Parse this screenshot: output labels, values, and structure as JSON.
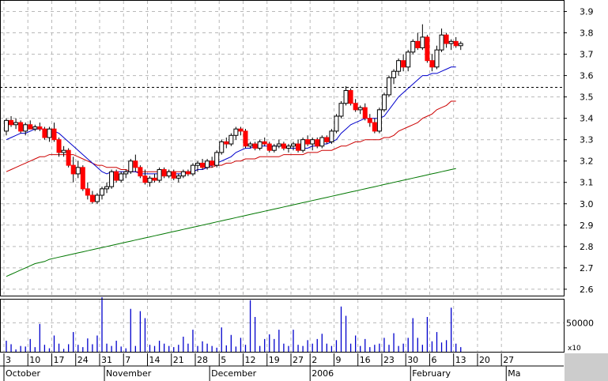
{
  "chart_data": {
    "type": "candlestick",
    "price_axis": {
      "ylim": [
        2.57,
        3.95
      ],
      "ticks": [
        "2.6",
        "2.7",
        "2.8",
        "2.9",
        "3.0",
        "3.1",
        "3.2",
        "3.3",
        "3.4",
        "3.5",
        "3.6",
        "3.7",
        "3.8",
        "3.9"
      ]
    },
    "volume_axis": {
      "ylim": [
        0,
        90000
      ],
      "tick_label": "50000",
      "multiplier_label": "x10"
    },
    "reference_line": 3.545,
    "date_ticks": [
      {
        "i": 0,
        "label": "3"
      },
      {
        "i": 5,
        "label": "10"
      },
      {
        "i": 10,
        "label": "17"
      },
      {
        "i": 15,
        "label": "24"
      },
      {
        "i": 20,
        "label": "31"
      },
      {
        "i": 25,
        "label": "7"
      },
      {
        "i": 30,
        "label": "14"
      },
      {
        "i": 35,
        "label": "21"
      },
      {
        "i": 40,
        "label": "28"
      },
      {
        "i": 45,
        "label": "5"
      },
      {
        "i": 50,
        "label": "12"
      },
      {
        "i": 55,
        "label": "19"
      },
      {
        "i": 60,
        "label": "27"
      },
      {
        "i": 64,
        "label": "2"
      },
      {
        "i": 69,
        "label": "9"
      },
      {
        "i": 74,
        "label": "16"
      },
      {
        "i": 79,
        "label": "23"
      },
      {
        "i": 84,
        "label": "30"
      },
      {
        "i": 89,
        "label": "6"
      },
      {
        "i": 94,
        "label": "13"
      },
      {
        "i": 99,
        "label": "20"
      },
      {
        "i": 104,
        "label": "27"
      }
    ],
    "months": [
      {
        "i": 0,
        "label": "October"
      },
      {
        "i": 21,
        "label": "November"
      },
      {
        "i": 43,
        "label": "December"
      },
      {
        "i": 64,
        "label": "2006"
      },
      {
        "i": 85,
        "label": "February"
      },
      {
        "i": 105,
        "label": "Ma"
      }
    ],
    "candles": [
      [
        3.34,
        3.4,
        3.32,
        3.39,
        19000
      ],
      [
        3.39,
        3.41,
        3.36,
        3.37,
        13000
      ],
      [
        3.37,
        3.4,
        3.35,
        3.38,
        4000
      ],
      [
        3.38,
        3.39,
        3.33,
        3.34,
        10000
      ],
      [
        3.34,
        3.38,
        3.32,
        3.37,
        9000
      ],
      [
        3.37,
        3.39,
        3.35,
        3.35,
        22000
      ],
      [
        3.35,
        3.37,
        3.34,
        3.36,
        8000
      ],
      [
        3.36,
        3.38,
        3.34,
        3.35,
        48000
      ],
      [
        3.35,
        3.36,
        3.3,
        3.31,
        12000
      ],
      [
        3.31,
        3.36,
        3.29,
        3.35,
        6000
      ],
      [
        3.35,
        3.38,
        3.29,
        3.3,
        28000
      ],
      [
        3.3,
        3.31,
        3.22,
        3.24,
        14000
      ],
      [
        3.24,
        3.27,
        3.22,
        3.25,
        5000
      ],
      [
        3.25,
        3.26,
        3.17,
        3.18,
        13000
      ],
      [
        3.18,
        3.22,
        3.1,
        3.14,
        34000
      ],
      [
        3.14,
        3.2,
        3.12,
        3.17,
        12000
      ],
      [
        3.17,
        3.18,
        3.06,
        3.07,
        8000
      ],
      [
        3.07,
        3.1,
        3.02,
        3.04,
        23000
      ],
      [
        3.04,
        3.06,
        3.0,
        3.01,
        13000
      ],
      [
        3.01,
        3.05,
        3.0,
        3.04,
        28000
      ],
      [
        3.04,
        3.08,
        3.02,
        3.07,
        94000
      ],
      [
        3.07,
        3.1,
        3.05,
        3.08,
        14000
      ],
      [
        3.08,
        3.16,
        3.07,
        3.15,
        10000
      ],
      [
        3.15,
        3.16,
        3.1,
        3.11,
        19000
      ],
      [
        3.11,
        3.15,
        3.1,
        3.14,
        9000
      ],
      [
        3.14,
        3.16,
        3.12,
        3.15,
        6000
      ],
      [
        3.15,
        3.21,
        3.14,
        3.2,
        74000
      ],
      [
        3.2,
        3.23,
        3.15,
        3.17,
        10000
      ],
      [
        3.17,
        3.18,
        3.12,
        3.13,
        70000
      ],
      [
        3.13,
        3.16,
        3.09,
        3.1,
        58000
      ],
      [
        3.1,
        3.13,
        3.08,
        3.12,
        12000
      ],
      [
        3.12,
        3.14,
        3.1,
        3.11,
        10000
      ],
      [
        3.11,
        3.17,
        3.1,
        3.16,
        19000
      ],
      [
        3.16,
        3.17,
        3.12,
        3.13,
        14000
      ],
      [
        3.13,
        3.16,
        3.12,
        3.15,
        10000
      ],
      [
        3.15,
        3.16,
        3.11,
        3.12,
        8000
      ],
      [
        3.12,
        3.14,
        3.1,
        3.13,
        12000
      ],
      [
        3.13,
        3.16,
        3.12,
        3.15,
        26000
      ],
      [
        3.15,
        3.16,
        3.13,
        3.14,
        14000
      ],
      [
        3.14,
        3.19,
        3.13,
        3.18,
        38000
      ],
      [
        3.18,
        3.2,
        3.15,
        3.19,
        10000
      ],
      [
        3.19,
        3.21,
        3.16,
        3.17,
        18000
      ],
      [
        3.17,
        3.21,
        3.16,
        3.2,
        14000
      ],
      [
        3.2,
        3.22,
        3.17,
        3.18,
        10000
      ],
      [
        3.18,
        3.25,
        3.17,
        3.24,
        7000
      ],
      [
        3.24,
        3.3,
        3.23,
        3.29,
        42000
      ],
      [
        3.29,
        3.31,
        3.26,
        3.28,
        11000
      ],
      [
        3.28,
        3.33,
        3.27,
        3.32,
        29000
      ],
      [
        3.32,
        3.36,
        3.3,
        3.35,
        9000
      ],
      [
        3.35,
        3.36,
        3.32,
        3.34,
        24000
      ],
      [
        3.34,
        3.35,
        3.26,
        3.27,
        12000
      ],
      [
        3.27,
        3.29,
        3.26,
        3.28,
        89000
      ],
      [
        3.28,
        3.29,
        3.25,
        3.26,
        60000
      ],
      [
        3.26,
        3.3,
        3.25,
        3.29,
        10000
      ],
      [
        3.29,
        3.31,
        3.27,
        3.28,
        22000
      ],
      [
        3.28,
        3.29,
        3.24,
        3.25,
        30000
      ],
      [
        3.25,
        3.28,
        3.24,
        3.27,
        22000
      ],
      [
        3.27,
        3.3,
        3.26,
        3.28,
        38000
      ],
      [
        3.28,
        3.29,
        3.25,
        3.26,
        14000
      ],
      [
        3.26,
        3.28,
        3.24,
        3.27,
        10000
      ],
      [
        3.27,
        3.29,
        3.25,
        3.28,
        38000
      ],
      [
        3.28,
        3.3,
        3.24,
        3.25,
        12000
      ],
      [
        3.25,
        3.31,
        3.24,
        3.3,
        10000
      ],
      [
        3.3,
        3.32,
        3.27,
        3.28,
        20000
      ],
      [
        3.28,
        3.31,
        3.25,
        3.3,
        14000
      ],
      [
        3.3,
        3.31,
        3.26,
        3.27,
        22000
      ],
      [
        3.27,
        3.32,
        3.26,
        3.31,
        31000
      ],
      [
        3.31,
        3.32,
        3.28,
        3.29,
        14000
      ],
      [
        3.29,
        3.35,
        3.28,
        3.34,
        10000
      ],
      [
        3.34,
        3.42,
        3.33,
        3.41,
        20000
      ],
      [
        3.41,
        3.48,
        3.4,
        3.47,
        78000
      ],
      [
        3.47,
        3.55,
        3.46,
        3.53,
        62000
      ],
      [
        3.53,
        3.54,
        3.46,
        3.47,
        14000
      ],
      [
        3.47,
        3.49,
        3.43,
        3.44,
        28000
      ],
      [
        3.44,
        3.46,
        3.42,
        3.45,
        10000
      ],
      [
        3.45,
        3.47,
        3.39,
        3.4,
        22000
      ],
      [
        3.4,
        3.42,
        3.36,
        3.38,
        8000
      ],
      [
        3.38,
        3.4,
        3.33,
        3.34,
        12000
      ],
      [
        3.34,
        3.45,
        3.33,
        3.44,
        14000
      ],
      [
        3.44,
        3.52,
        3.43,
        3.51,
        24000
      ],
      [
        3.51,
        3.6,
        3.5,
        3.59,
        12000
      ],
      [
        3.59,
        3.63,
        3.56,
        3.62,
        32000
      ],
      [
        3.62,
        3.68,
        3.6,
        3.67,
        10000
      ],
      [
        3.67,
        3.7,
        3.62,
        3.64,
        14000
      ],
      [
        3.64,
        3.72,
        3.62,
        3.71,
        24000
      ],
      [
        3.71,
        3.77,
        3.7,
        3.76,
        58000
      ],
      [
        3.76,
        3.8,
        3.72,
        3.73,
        24000
      ],
      [
        3.73,
        3.84,
        3.72,
        3.78,
        12000
      ],
      [
        3.78,
        3.79,
        3.66,
        3.67,
        60000
      ],
      [
        3.67,
        3.7,
        3.62,
        3.64,
        18000
      ],
      [
        3.64,
        3.74,
        3.63,
        3.72,
        34000
      ],
      [
        3.72,
        3.82,
        3.71,
        3.79,
        16000
      ],
      [
        3.79,
        3.8,
        3.73,
        3.75,
        20000
      ],
      [
        3.75,
        3.77,
        3.72,
        3.76,
        76000
      ],
      [
        3.76,
        3.78,
        3.73,
        3.74,
        14000
      ],
      [
        3.74,
        3.76,
        3.72,
        3.75,
        8000
      ]
    ],
    "ma_short": [
      3.3,
      3.31,
      3.32,
      3.33,
      3.33,
      3.34,
      3.35,
      3.35,
      3.35,
      3.34,
      3.34,
      3.33,
      3.31,
      3.29,
      3.27,
      3.25,
      3.23,
      3.21,
      3.19,
      3.17,
      3.15,
      3.14,
      3.15,
      3.15,
      3.15,
      3.15,
      3.15,
      3.15,
      3.14,
      3.14,
      3.14,
      3.14,
      3.14,
      3.14,
      3.14,
      3.14,
      3.14,
      3.14,
      3.15,
      3.15,
      3.16,
      3.16,
      3.17,
      3.18,
      3.19,
      3.2,
      3.21,
      3.22,
      3.24,
      3.25,
      3.26,
      3.26,
      3.27,
      3.27,
      3.27,
      3.27,
      3.27,
      3.27,
      3.27,
      3.26,
      3.26,
      3.26,
      3.26,
      3.26,
      3.27,
      3.27,
      3.28,
      3.28,
      3.29,
      3.3,
      3.33,
      3.35,
      3.37,
      3.38,
      3.39,
      3.4,
      3.4,
      3.4,
      3.4,
      3.41,
      3.44,
      3.47,
      3.5,
      3.52,
      3.54,
      3.56,
      3.58,
      3.6,
      3.6,
      3.61,
      3.61,
      3.62,
      3.63,
      3.64,
      3.64
    ],
    "ma_mid": [
      3.15,
      3.16,
      3.17,
      3.18,
      3.19,
      3.2,
      3.21,
      3.22,
      3.22,
      3.23,
      3.23,
      3.23,
      3.23,
      3.23,
      3.23,
      3.22,
      3.21,
      3.2,
      3.19,
      3.18,
      3.18,
      3.17,
      3.17,
      3.17,
      3.16,
      3.16,
      3.15,
      3.15,
      3.15,
      3.15,
      3.15,
      3.15,
      3.15,
      3.15,
      3.15,
      3.15,
      3.15,
      3.15,
      3.15,
      3.15,
      3.16,
      3.16,
      3.17,
      3.17,
      3.18,
      3.18,
      3.19,
      3.19,
      3.2,
      3.2,
      3.21,
      3.21,
      3.21,
      3.22,
      3.22,
      3.22,
      3.22,
      3.22,
      3.23,
      3.23,
      3.23,
      3.23,
      3.23,
      3.24,
      3.24,
      3.24,
      3.25,
      3.25,
      3.25,
      3.26,
      3.27,
      3.27,
      3.28,
      3.29,
      3.29,
      3.3,
      3.3,
      3.3,
      3.3,
      3.31,
      3.31,
      3.32,
      3.34,
      3.35,
      3.36,
      3.37,
      3.38,
      3.4,
      3.41,
      3.42,
      3.44,
      3.45,
      3.46,
      3.48,
      3.48
    ],
    "ma_long": [
      2.66,
      2.67,
      2.68,
      2.69,
      2.7,
      2.71,
      2.72,
      2.725,
      2.73,
      2.74,
      2.745,
      2.75,
      2.755,
      2.76,
      2.765,
      2.77,
      2.775,
      2.78,
      2.785,
      2.79,
      2.795,
      2.8,
      2.805,
      2.81,
      2.815,
      2.82,
      2.825,
      2.83,
      2.835,
      2.84,
      2.845,
      2.85,
      2.855,
      2.86,
      2.865,
      2.87,
      2.875,
      2.88,
      2.885,
      2.89,
      2.895,
      2.9,
      2.905,
      2.91,
      2.915,
      2.92,
      2.925,
      2.93,
      2.935,
      2.94,
      2.945,
      2.95,
      2.955,
      2.96,
      2.965,
      2.97,
      2.975,
      2.98,
      2.985,
      2.99,
      2.995,
      3.0,
      3.005,
      3.01,
      3.015,
      3.02,
      3.025,
      3.03,
      3.035,
      3.04,
      3.045,
      3.05,
      3.055,
      3.06,
      3.065,
      3.07,
      3.075,
      3.08,
      3.085,
      3.09,
      3.095,
      3.1,
      3.105,
      3.11,
      3.115,
      3.12,
      3.125,
      3.13,
      3.135,
      3.14,
      3.145,
      3.15,
      3.155,
      3.16,
      3.165
    ],
    "colors": {
      "bull": "#ffffff",
      "bear": "#ff0000",
      "outline": "#000000",
      "ma_short": "#0000cc",
      "ma_mid": "#cc0000",
      "ma_long": "#007700",
      "volume": "#0000cc",
      "reference": "#000000"
    }
  }
}
